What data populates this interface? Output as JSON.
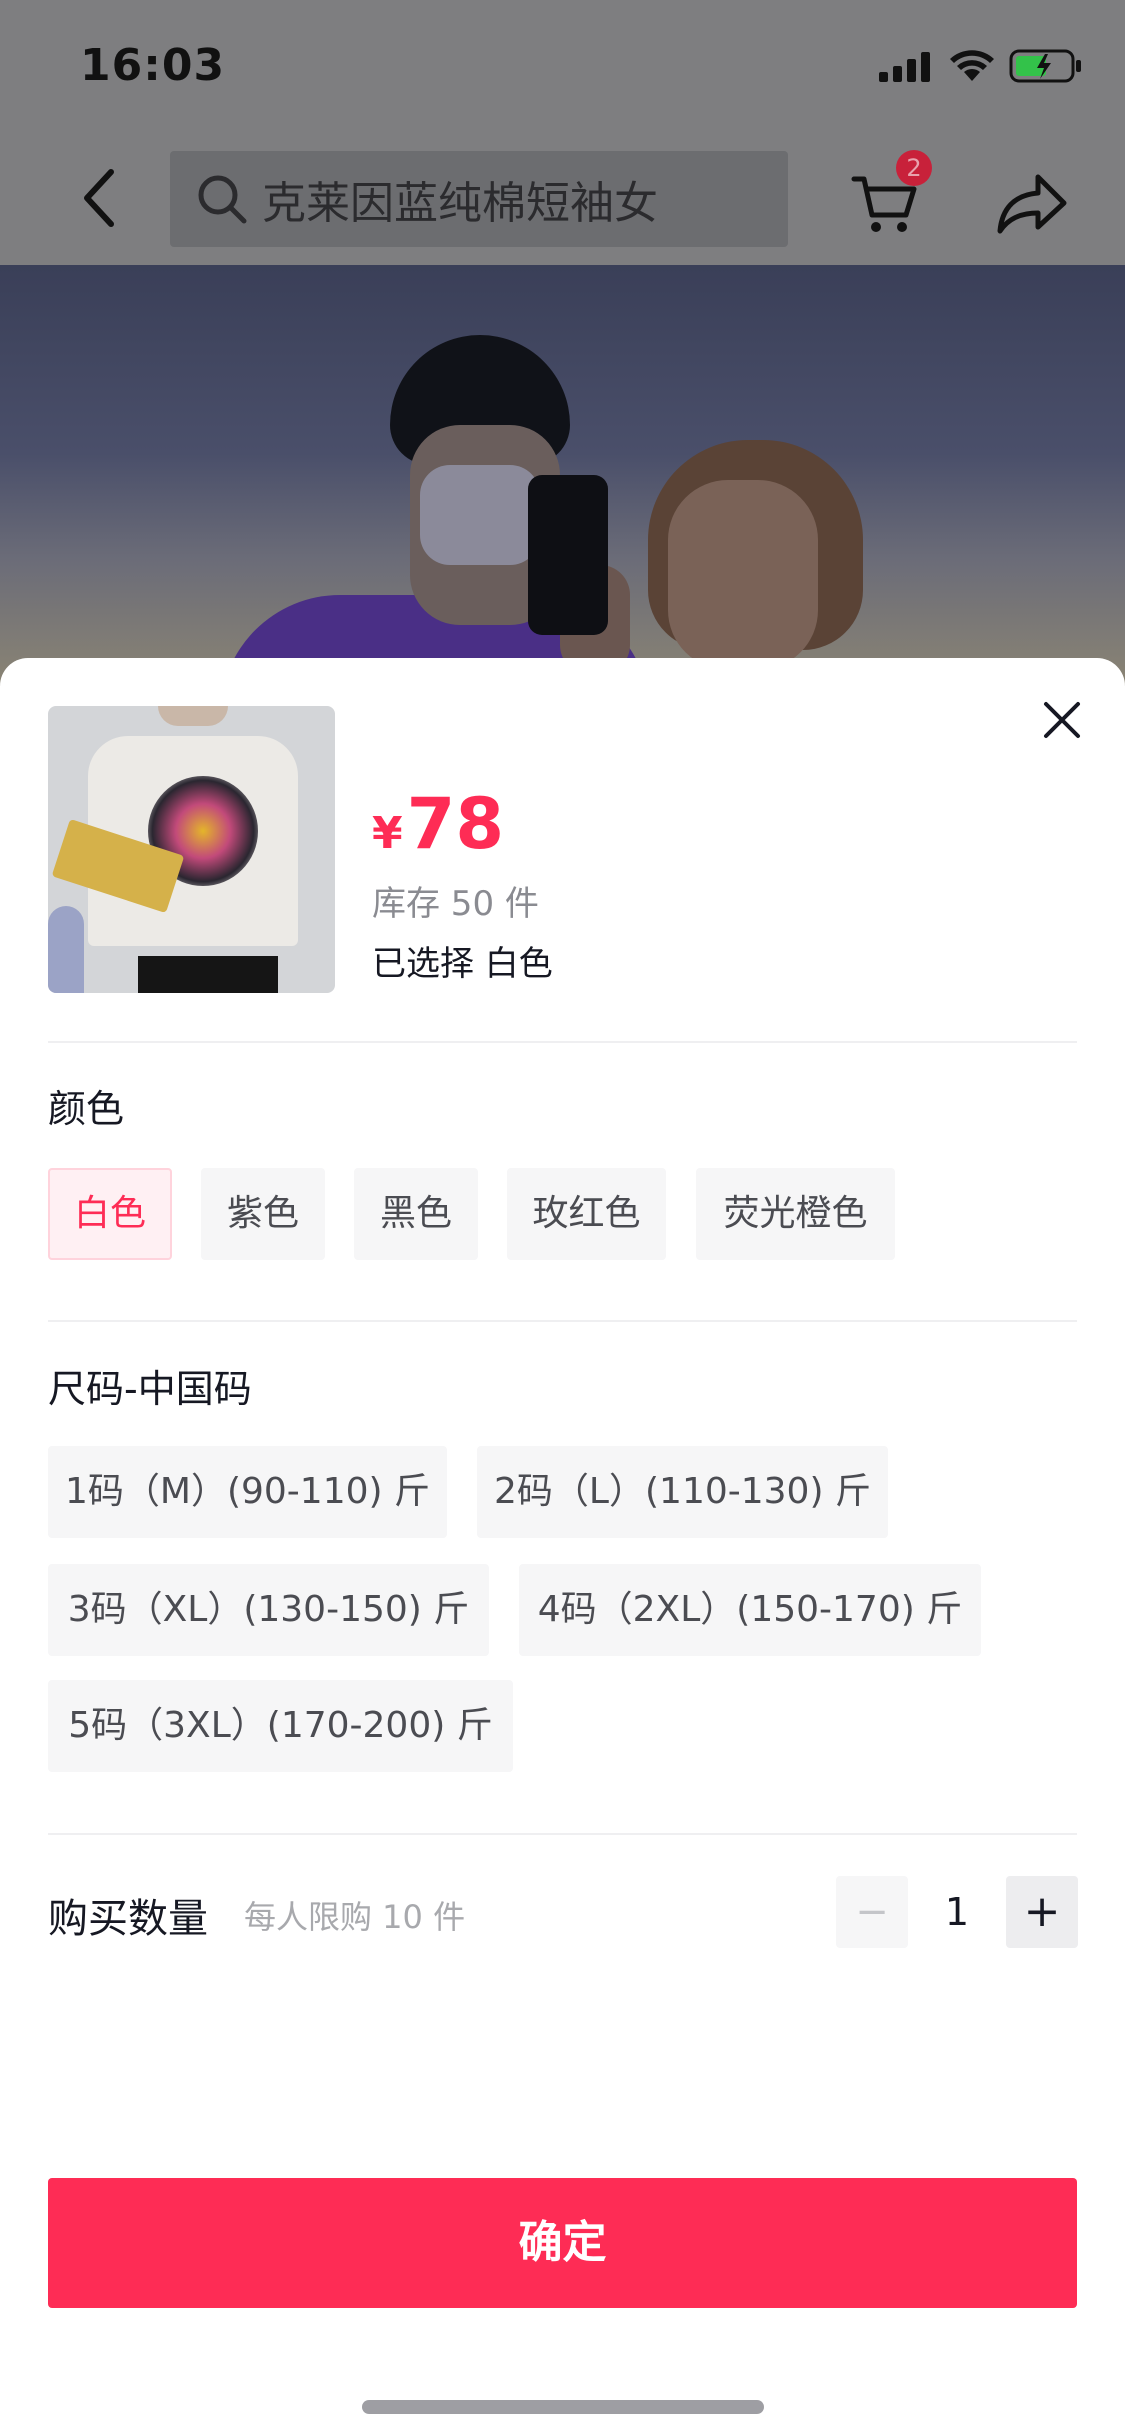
{
  "status_bar": {
    "time": "16:03"
  },
  "header": {
    "search_text": "克莱因蓝纯棉短袖女",
    "cart_badge": "2",
    "icons": {
      "back": "chevron-left-icon",
      "search": "search-icon",
      "cart": "cart-icon",
      "share": "share-icon"
    }
  },
  "sheet": {
    "price_currency": "¥",
    "price": "78",
    "stock": "库存 50 件",
    "selected": "已选择 白色",
    "color_section": {
      "title": "颜色",
      "options": [
        {
          "label": "白色",
          "selected": true
        },
        {
          "label": "紫色",
          "selected": false
        },
        {
          "label": "黑色",
          "selected": false
        },
        {
          "label": "玫红色",
          "selected": false
        },
        {
          "label": "荧光橙色",
          "selected": false
        }
      ]
    },
    "size_section": {
      "title": "尺码-中国码",
      "options": [
        {
          "label": "1码（M）(90-110) 斤"
        },
        {
          "label": "2码（L）(110-130) 斤"
        },
        {
          "label": "3码（XL）(130-150) 斤"
        },
        {
          "label": "4码（2XL）(150-170) 斤"
        },
        {
          "label": "5码（3XL）(170-200) 斤"
        }
      ]
    },
    "quantity": {
      "label": "购买数量",
      "hint": "每人限购 10 件",
      "value": "1",
      "minus": "−",
      "plus": "+"
    },
    "confirm_label": "确定"
  },
  "colors": {
    "accent": "#fe2c55",
    "chip_bg": "#f6f6f7",
    "chip_active_bg": "#fff0f3"
  }
}
